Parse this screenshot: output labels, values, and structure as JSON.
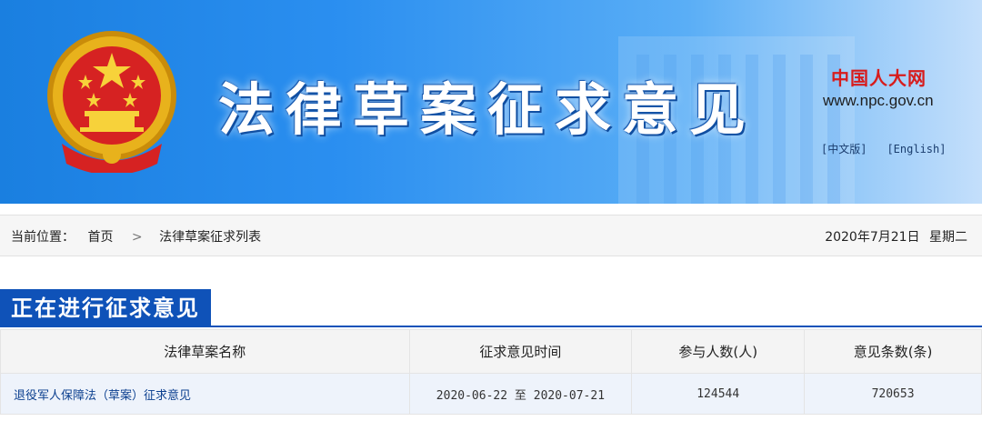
{
  "banner": {
    "title": "法律草案征求意见",
    "site_name": "中国人大网",
    "site_url": "www.npc.gov.cn",
    "lang_cn": "[中文版]",
    "lang_en": "[English]"
  },
  "breadcrumb": {
    "label": "当前位置：",
    "home": "首页",
    "separator": ">",
    "current": "法律草案征求列表",
    "date": "2020年7月21日",
    "weekday": "星期二"
  },
  "section": {
    "heading": "正在进行征求意见"
  },
  "table": {
    "headers": [
      "法律草案名称",
      "征求意见时间",
      "参与人数(人)",
      "意见条数(条)"
    ],
    "rows": [
      {
        "name": "退役军人保障法（草案）征求意见",
        "start": "2020-06-22",
        "to": "至",
        "end": "2020-07-21",
        "participants": "124544",
        "comments": "720653"
      }
    ]
  },
  "colors": {
    "banner_blue": "#1a7fe0",
    "section_blue": "#0f52b8",
    "site_red": "#d71c1c"
  },
  "icons": {
    "emblem": "national-emblem-icon"
  }
}
